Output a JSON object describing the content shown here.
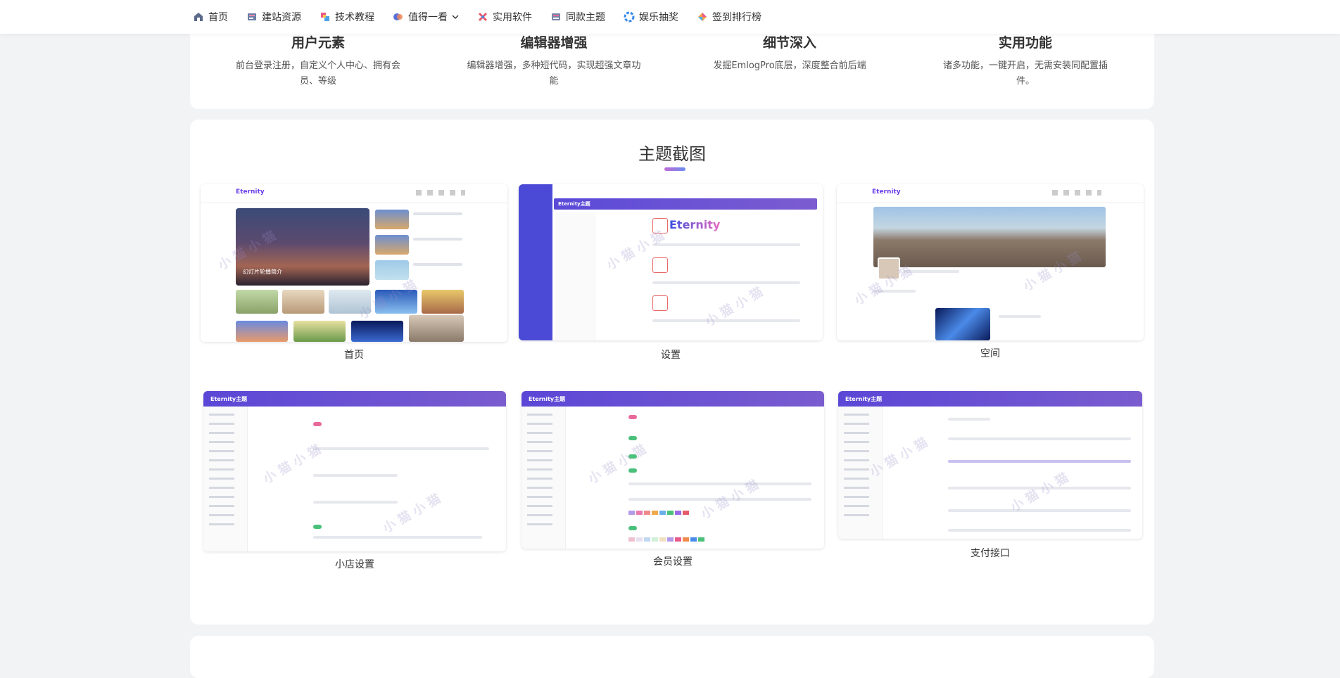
{
  "nav": {
    "items": [
      {
        "label": "首页",
        "icon": "home-icon"
      },
      {
        "label": "建站资源",
        "icon": "resource-icon"
      },
      {
        "label": "技术教程",
        "icon": "tutorial-icon"
      },
      {
        "label": "值得一看",
        "icon": "view-icon",
        "has_dropdown": true
      },
      {
        "label": "实用软件",
        "icon": "software-icon"
      },
      {
        "label": "同款主题",
        "icon": "theme-icon"
      },
      {
        "label": "娱乐抽奖",
        "icon": "lottery-icon"
      },
      {
        "label": "签到排行榜",
        "icon": "ranking-icon"
      }
    ]
  },
  "features": [
    {
      "title": "用户元素",
      "desc": "前台登录注册，自定义个人中心、拥有会员、等级"
    },
    {
      "title": "编辑器增强",
      "desc": "编辑器增强，多种短代码，实现超强文章功能"
    },
    {
      "title": "细节深入",
      "desc": "发掘EmlogPro底层，深度整合前后端"
    },
    {
      "title": "实用功能",
      "desc": "诸多功能，一键开启，无需安装同配置插件。"
    }
  ],
  "screenshots": {
    "title": "主题截图",
    "items": [
      {
        "caption": "首页"
      },
      {
        "caption": "设置"
      },
      {
        "caption": "空间"
      },
      {
        "caption": "小店设置"
      },
      {
        "caption": "会员设置"
      },
      {
        "caption": "支付接口"
      }
    ],
    "mock": {
      "logo": "Eternity",
      "admin_title": "Eternity主题",
      "hero_text": "幻灯片轮播简介"
    }
  },
  "colors": {
    "accent": "#6a5cd6",
    "title_bar_start": "#c16ad6",
    "title_bar_end": "#6a8cf0",
    "page_bg": "#f2f3f5"
  }
}
